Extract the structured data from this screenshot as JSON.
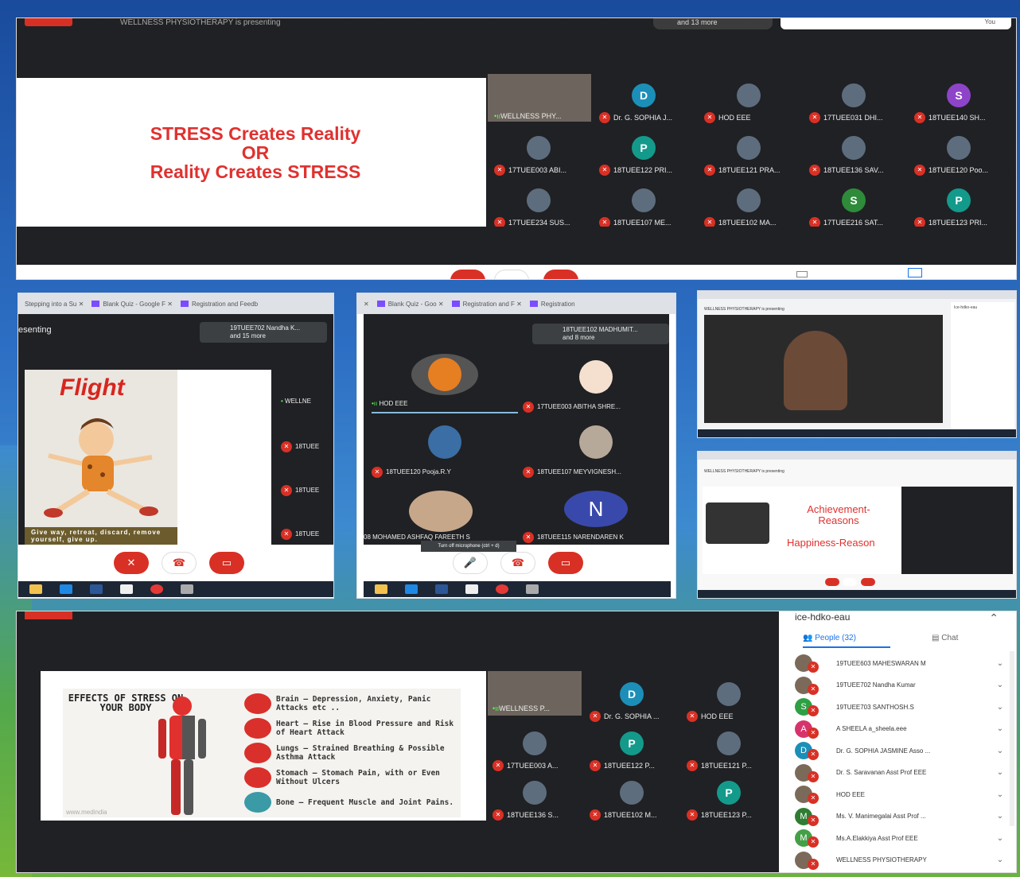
{
  "shot1": {
    "topbar_left": "WELLNESS PHYSIOTHERAPY is presenting",
    "topbar_more": "and 13 more",
    "topbar_you": "You",
    "slide_lines": [
      "STRESS Creates Reality",
      "OR",
      "Reality Creates STRESS"
    ],
    "participants": [
      {
        "name": "WELLNESS PHY...",
        "type": "video"
      },
      {
        "name": "Dr. G. SOPHIA J...",
        "initial": "D",
        "color": "#1c8fb8"
      },
      {
        "name": "HOD EEE",
        "type": "photo"
      },
      {
        "name": "17TUEE031 DHI...",
        "type": "photo"
      },
      {
        "name": "18TUEE140 SH...",
        "initial": "S",
        "color": "#8e44c9"
      },
      {
        "name": "17TUEE003 ABI...",
        "type": "photo"
      },
      {
        "name": "18TUEE122 PRI...",
        "initial": "P",
        "color": "#139a8b"
      },
      {
        "name": "18TUEE121 PRA...",
        "type": "photo"
      },
      {
        "name": "18TUEE136 SAV...",
        "type": "photo"
      },
      {
        "name": "18TUEE120 Poo...",
        "type": "photo"
      },
      {
        "name": "17TUEE234 SUS...",
        "type": "photo"
      },
      {
        "name": "18TUEE107 ME...",
        "type": "photo"
      },
      {
        "name": "18TUEE102 MA...",
        "type": "photo"
      },
      {
        "name": "17TUEE216 SAT...",
        "initial": "S",
        "color": "#2e8b3a"
      },
      {
        "name": "18TUEE123 PRI...",
        "initial": "P",
        "color": "#139a8b"
      }
    ]
  },
  "shot2": {
    "tabs": [
      "Stepping into a Su",
      "Blank Quiz - Google F",
      "Registration and Feedb"
    ],
    "presenting": "esenting",
    "presenter_name": "19TUEE702 Nandha K...",
    "presenter_more": "and 15 more",
    "slide_title": "Flight",
    "slide_caption": "Give way, retreat, discard, remove yourself, give up.",
    "side_tiles": [
      "WELLNE",
      "18TUEE",
      "18TUEE",
      "18TUEE"
    ]
  },
  "shot3": {
    "tabs": [
      "Blank Quiz - Goo",
      "Registration and F",
      "Registration"
    ],
    "presenter_name": "18TUEE102 MADHUMIT...",
    "presenter_more": "and 8 more",
    "tiles": [
      {
        "name": "HOD EEE"
      },
      {
        "name": "17TUEE003 ABITHA SHRE..."
      },
      {
        "name": "18TUEE120 Pooja.R.Y"
      },
      {
        "name": "18TUEE107 MEYVIGNESH..."
      },
      {
        "name": "08 MOHAMED ASHFAQ FAREETH S"
      },
      {
        "name": "18TUEE115 NARENDAREN K",
        "initial": "N"
      }
    ],
    "tooltip": "Turn off microphone (ctrl + d)"
  },
  "shot4": {
    "presenting": "WELLNESS PHYSIOTHERAPY is presenting",
    "side_title": "Ice-hdko-eau"
  },
  "shot5": {
    "presenting": "WELLNESS PHYSIOTHERAPY is presenting",
    "slide_lines": [
      "Achievement-",
      "Reasons",
      "Happiness-Reason"
    ]
  },
  "shot6": {
    "meeting_code": "ice-hdko-eau",
    "people_tab": "People (32)",
    "chat_tab": "Chat",
    "slide_title": "EFFECTS OF STRESS ON YOUR BODY",
    "slide_items": [
      {
        "title": "Brain – Depression, Anxiety, Panic Attacks etc ..",
        "color": "#d9302c"
      },
      {
        "title": "Heart – Rise in Blood Pressure and Risk of Heart Attack",
        "color": "#d9302c"
      },
      {
        "title": "Lungs – Strained Breathing & Possible Asthma Attack",
        "color": "#d9302c"
      },
      {
        "title": "Stomach – Stomach Pain, with or Even Without Ulcers",
        "color": "#d9302c"
      },
      {
        "title": "Bone – Frequent Muscle and Joint Pains.",
        "color": "#3a9aa6"
      }
    ],
    "slide_watermark": "www.medindia",
    "grid": [
      {
        "name": "WELLNESS P..."
      },
      {
        "name": "Dr. G. SOPHIA ...",
        "initial": "D",
        "color": "#1c8fb8"
      },
      {
        "name": "HOD EEE"
      },
      {
        "name": "17TUEE003 A..."
      },
      {
        "name": "18TUEE122 P...",
        "initial": "P",
        "color": "#139a8b"
      },
      {
        "name": "18TUEE121 P..."
      },
      {
        "name": "18TUEE136 S..."
      },
      {
        "name": "18TUEE102 M..."
      },
      {
        "name": "18TUEE123 P...",
        "initial": "P",
        "color": "#139a8b"
      }
    ],
    "people": [
      {
        "name": "19TUEE603 MAHESWARAN M",
        "avatar": "photo"
      },
      {
        "name": "19TUEE702 Nandha Kumar",
        "avatar": "photo"
      },
      {
        "name": "19TUEE703 SANTHOSH.S",
        "initial": "S",
        "color": "#2ea043"
      },
      {
        "name": "A SHEELA a_sheela.eee",
        "initial": "A",
        "color": "#d6336c"
      },
      {
        "name": "Dr. G. SOPHIA JASMINE Asso ...",
        "initial": "D",
        "color": "#1c8fb8"
      },
      {
        "name": "Dr. S. Saravanan Asst Prof EEE",
        "avatar": "photo"
      },
      {
        "name": "HOD EEE",
        "avatar": "photo"
      },
      {
        "name": "Ms. V. Manimegalai Asst Prof ...",
        "initial": "M",
        "color": "#2e7d32"
      },
      {
        "name": "Ms.A.Elakkiya Asst Prof EEE",
        "initial": "M",
        "color": "#43a047"
      },
      {
        "name": "WELLNESS PHYSIOTHERAPY",
        "avatar": "photo"
      }
    ]
  }
}
